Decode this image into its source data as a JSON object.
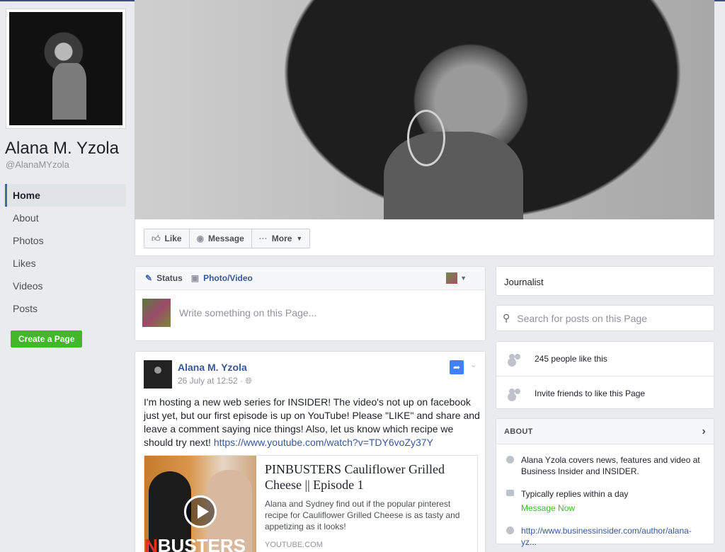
{
  "page": {
    "name": "Alana M. Yzola",
    "handle": "@AlanaMYzola"
  },
  "sidebar": {
    "items": [
      {
        "label": "Home",
        "active": true
      },
      {
        "label": "About"
      },
      {
        "label": "Photos"
      },
      {
        "label": "Likes"
      },
      {
        "label": "Videos"
      },
      {
        "label": "Posts"
      }
    ],
    "create_page": "Create a Page"
  },
  "actions": {
    "like": "Like",
    "message": "Message",
    "more": "More"
  },
  "composer": {
    "status_tab": "Status",
    "photo_tab": "Photo/Video",
    "placeholder": "Write something on this Page..."
  },
  "post": {
    "author": "Alana M. Yzola",
    "date": "26 July at 12:52",
    "text": "I'm hosting a new web series for INSIDER! The video's not up on facebook just yet, but our first episode is up on YouTube! Please \"LIKE\" and share and leave a comment saying nice things! Also, let us know which recipe we should try next!",
    "url": "https://www.youtube.com/watch?v=TDY6voZy37Y",
    "link": {
      "title": "PINBUSTERS Cauliflower Grilled Cheese || Episode 1",
      "description": "Alana and Sydney find out if the popular pinterest recipe for Cauliflower Grilled Cheese is as tasty and appetizing as it looks!",
      "domain": "YOUTUBE.COM",
      "thumb_text_red": "N",
      "thumb_text": "BUSTERS"
    }
  },
  "right": {
    "category": "Journalist",
    "search_placeholder": "Search for posts on this Page",
    "likes_count": "245 people like this",
    "invite": "Invite friends to like this Page",
    "about": {
      "heading": "ABOUT",
      "description": "Alana Yzola covers news, features and video at Business Insider and INSIDER.",
      "replies": "Typically replies within a day",
      "message_now": "Message Now",
      "website": "http://www.businessinsider.com/author/alana-yz..."
    }
  },
  "colors": {
    "accent": "#4267b2",
    "link": "#365899",
    "green": "#42b72a",
    "background": "#e9ebee"
  }
}
